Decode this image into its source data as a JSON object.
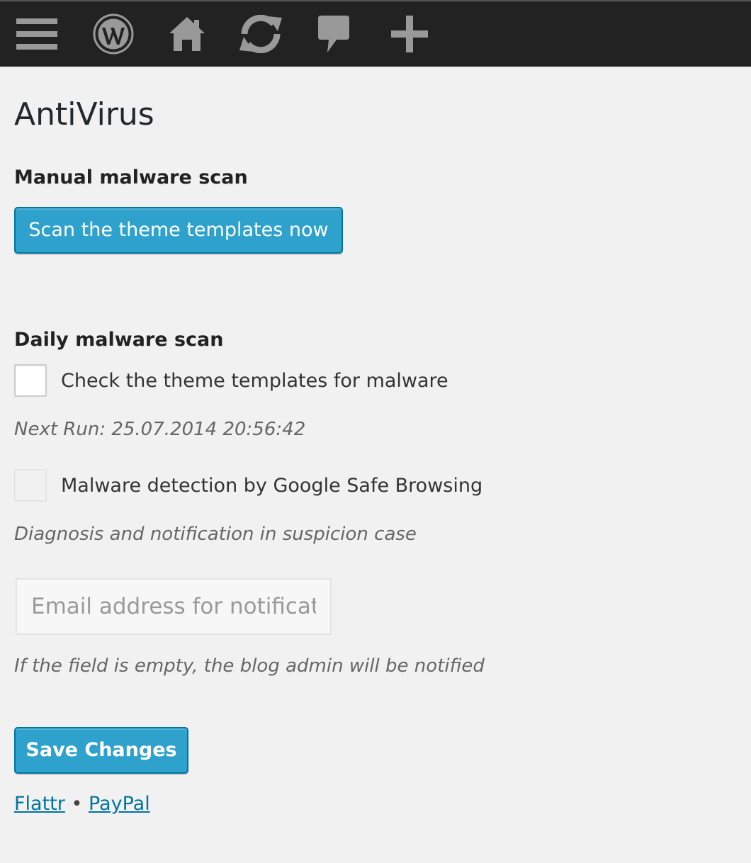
{
  "admin_bar": {
    "icons": [
      "menu-icon",
      "wordpress-logo-icon",
      "home-icon",
      "updates-icon",
      "comments-icon",
      "new-content-icon"
    ]
  },
  "page": {
    "title": "AntiVirus"
  },
  "manual_scan": {
    "heading": "Manual malware scan",
    "button_label": "Scan the theme templates now"
  },
  "daily_scan": {
    "heading": "Daily malware scan",
    "check_templates_label": "Check the theme templates for malware",
    "next_run": "Next Run: 25.07.2014 20:56:42",
    "safe_browsing_label": "Malware detection by Google Safe Browsing",
    "safe_browsing_desc": "Diagnosis and notification in suspicion case",
    "email_placeholder": "Email address for notifications",
    "email_value": "",
    "email_desc": "If the field is empty, the blog admin will be notified"
  },
  "save_label": "Save Changes",
  "footer_links": {
    "flattr": "Flattr",
    "separator": "•",
    "paypal": "PayPal"
  },
  "colors": {
    "admin_bar_bg": "#222222",
    "admin_bar_icon": "#999999",
    "primary_button": "#2ea2cc",
    "link": "#0074a2",
    "page_bg": "#f1f1f1"
  }
}
